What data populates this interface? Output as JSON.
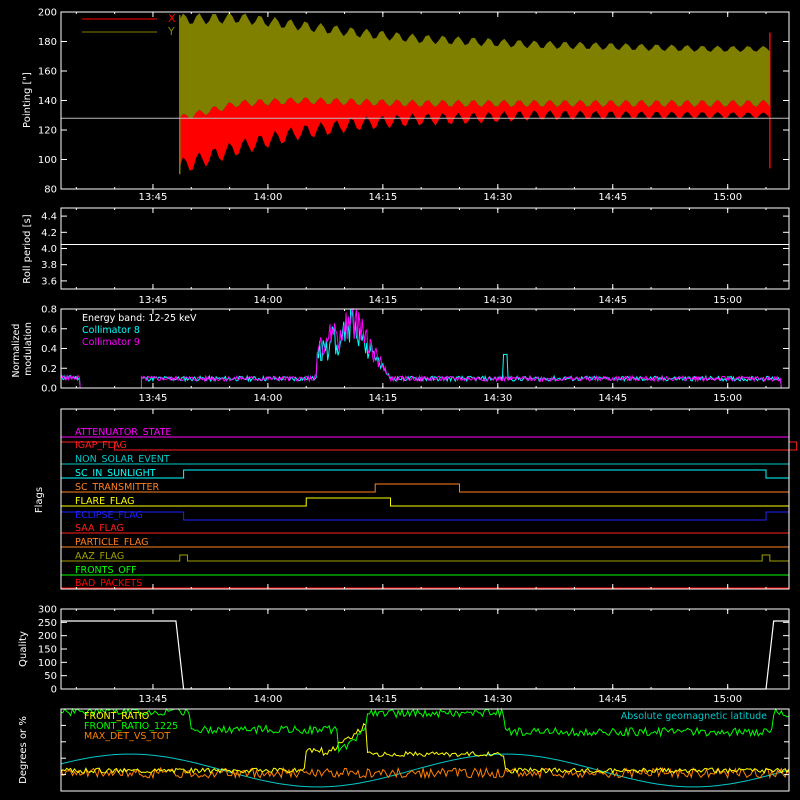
{
  "time_ticks": [
    "13:45",
    "14:00",
    "14:15",
    "14:30",
    "14:45",
    "15:00"
  ],
  "chart_data": [
    {
      "type": "line",
      "ylabel": "Pointing [\"]",
      "ylim": [
        80,
        200
      ],
      "yticks": [
        "80",
        "100",
        "120",
        "140",
        "160",
        "180",
        "200"
      ],
      "series": [
        {
          "name": "X",
          "color": "#ff0000",
          "lower": [
            95,
            108,
            118,
            124,
            127,
            128,
            130,
            130,
            130,
            130,
            130
          ],
          "upper": [
            128,
            138,
            140,
            139,
            138,
            138,
            138,
            138,
            138,
            138,
            138
          ]
        },
        {
          "name": "Y",
          "color": "#808000",
          "lower": [
            128,
            138,
            140,
            139,
            138,
            138,
            138,
            138,
            138,
            138,
            138
          ],
          "upper": [
            195,
            196,
            191,
            186,
            182,
            180,
            178,
            177,
            176,
            175,
            175
          ]
        }
      ],
      "reference_level": 128,
      "legend": "top-left"
    },
    {
      "type": "line",
      "ylabel": "Roll period [s]",
      "ylim": [
        3.5,
        4.5
      ],
      "yticks": [
        "3.6",
        "3.8",
        "4.0",
        "4.2",
        "4.4"
      ],
      "series": [
        {
          "color": "#ffffff",
          "values": [
            4.05,
            4.05
          ]
        }
      ]
    },
    {
      "type": "line",
      "ylabel": [
        "Normalized",
        "modulation"
      ],
      "ylim": [
        0,
        0.8
      ],
      "yticks": [
        "0.0",
        "0.2",
        "0.4",
        "0.6",
        "0.8"
      ],
      "annotation": "Energy band: 12-25 keV",
      "series": [
        {
          "name": "Collimator 8",
          "color": "#00ffff"
        },
        {
          "name": "Collimator 9",
          "color": "#ff00ff"
        }
      ],
      "baseline": 0.08,
      "flare_peak": 0.8
    },
    {
      "type": "line",
      "ylabel": "Flags",
      "flags": [
        {
          "name": "ATTENUATOR_STATE",
          "color": "#ff00ff"
        },
        {
          "name": "IGAP_FLAG",
          "color": "#ff2020"
        },
        {
          "name": "NON_SOLAR_EVENT",
          "color": "#00c8c8"
        },
        {
          "name": "SC_IN_SUNLIGHT",
          "color": "#00ffff"
        },
        {
          "name": "SC_TRANSMITTER",
          "color": "#ff8020"
        },
        {
          "name": "FLARE_FLAG",
          "color": "#ffff00"
        },
        {
          "name": "ECLIPSE_FLAG",
          "color": "#2020ff"
        },
        {
          "name": "SAA_FLAG",
          "color": "#ff2020"
        },
        {
          "name": "PARTICLE_FLAG",
          "color": "#ff8020"
        },
        {
          "name": "AAZ_FLAG",
          "color": "#a0a000"
        },
        {
          "name": "FRONTS_OFF",
          "color": "#00ff00"
        },
        {
          "name": "BAD_PACKETS",
          "color": "#ff0000"
        }
      ]
    },
    {
      "type": "line",
      "ylabel": "Quality",
      "ylim": [
        0,
        300
      ],
      "yticks": [
        "0",
        "50",
        "100",
        "150",
        "200",
        "250",
        "300"
      ],
      "series": [
        {
          "color": "#ffffff",
          "high": 255,
          "low": 0
        }
      ]
    },
    {
      "type": "line",
      "ylabel": "Degrees or %",
      "ylim": [
        0,
        100
      ],
      "series": [
        {
          "name": "FRONT_RATIO",
          "color": "#ffff00"
        },
        {
          "name": "FRONT_RATIO_1225",
          "color": "#00ff00"
        },
        {
          "name": "MAX_DET_VS_TOT",
          "color": "#ff8000"
        },
        {
          "name": "Absolute geomagnetic latitude",
          "color": "#00c8c8"
        }
      ],
      "legend": "top-left / top-right"
    }
  ]
}
